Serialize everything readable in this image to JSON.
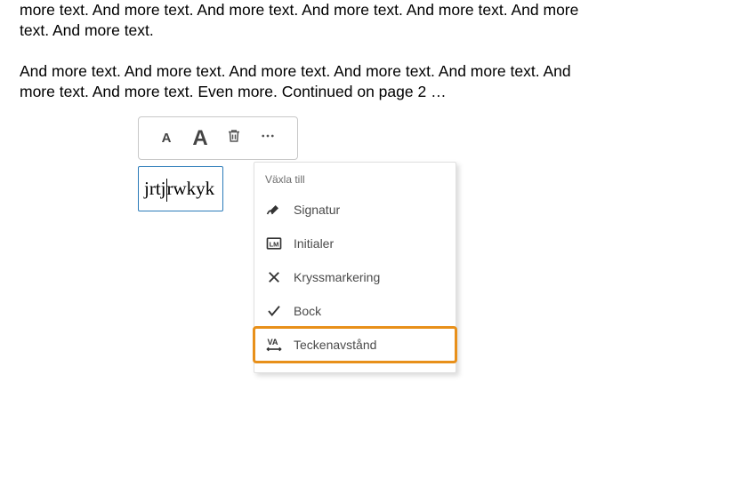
{
  "document": {
    "paragraph1": "more text. And more text. And more text. And more text. And more text. And more text. And more text.",
    "paragraph2": "And more text. And more text. And more text. And more text. And more text. And more text. And more text. Even more. Continued on page 2 …"
  },
  "textfield": {
    "before": "jrtj",
    "after": "rwkyk"
  },
  "menu": {
    "header": "Växla till",
    "items": {
      "signature": "Signatur",
      "initials": "Initialer",
      "crossmark": "Kryssmarkering",
      "checkmark": "Bock",
      "spacing": "Teckenavstånd"
    }
  }
}
